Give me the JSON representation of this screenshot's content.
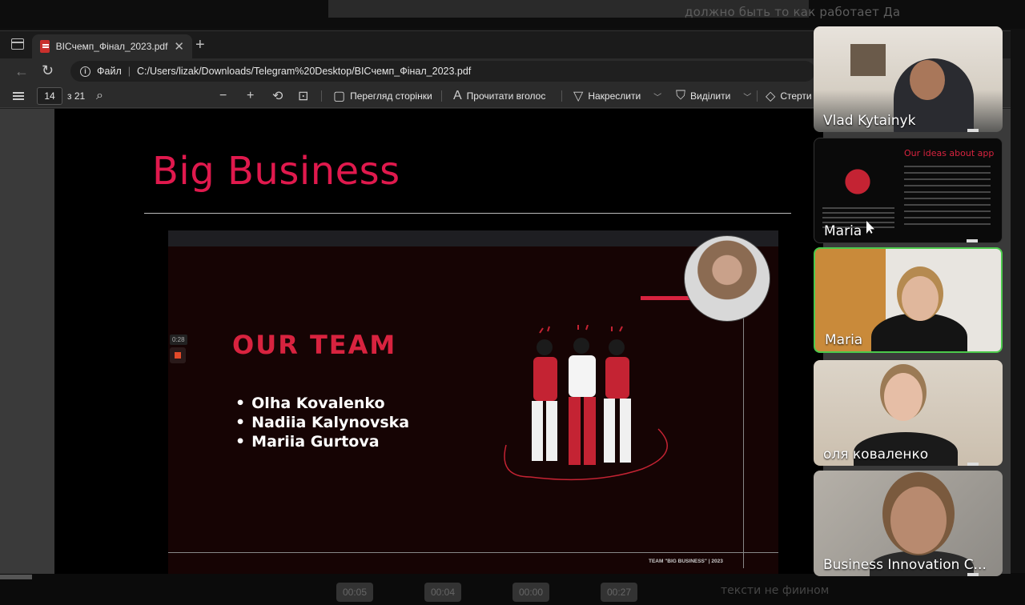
{
  "background": {
    "top_text": "должно быть то как работает Да",
    "bottom_text": "тексти не фиином",
    "bottom_chips": [
      "00:05",
      "00:04",
      "00:00",
      "00:27"
    ]
  },
  "browser": {
    "tab_title": "BICчемп_Фінал_2023.pdf",
    "address_label": "Файл",
    "url": "C:/Users/lizak/Downloads/Telegram%20Desktop/BICчемп_Фінал_2023.pdf"
  },
  "pdf_toolbar": {
    "page_current": "14",
    "page_total": "з 21",
    "page_view": "Перегляд сторінки",
    "read_aloud": "Прочитати вголос",
    "draw": "Накреслити",
    "highlight": "Виділити",
    "erase": "Стерти"
  },
  "slide": {
    "title": "Big Business",
    "video": {
      "time": "0:28",
      "heading": "OUR TEAM",
      "members": [
        "Olha Kovalenko",
        "Nadiia Kalynovska",
        "Mariia Gurtova"
      ],
      "footer": "TEAM \"BIG BUSINESS\" | 2023"
    }
  },
  "participants": [
    {
      "name": "Vlad Kytainyk"
    },
    {
      "name": "Maria",
      "shared_slide_title": "Our ideas about app"
    },
    {
      "name": "Maria",
      "active": true
    },
    {
      "name": "оля коваленко"
    },
    {
      "name": "Business Innovation C..."
    }
  ],
  "colors": {
    "accent_red": "#e0194d",
    "active_border": "#4cc94c"
  }
}
